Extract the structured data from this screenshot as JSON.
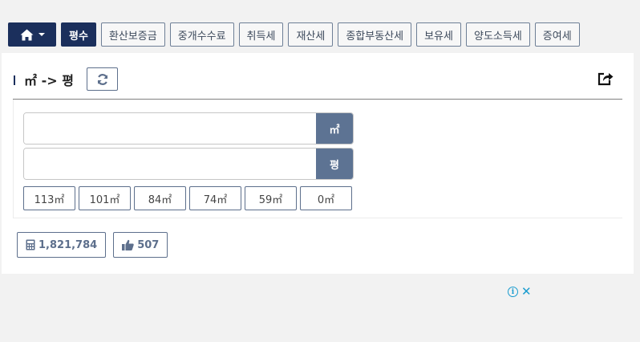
{
  "nav": {
    "home_icon": "home-icon",
    "items": [
      {
        "label": "평수",
        "active": true
      },
      {
        "label": "환산보증금"
      },
      {
        "label": "중개수수료"
      },
      {
        "label": "취득세"
      },
      {
        "label": "재산세"
      },
      {
        "label": "종합부동산세"
      },
      {
        "label": "보유세"
      },
      {
        "label": "양도소득세"
      },
      {
        "label": "증여세"
      }
    ]
  },
  "calculator": {
    "title": "㎡ -> 평",
    "refresh_icon": "refresh-icon",
    "share_icon": "share-icon",
    "input_sqm": {
      "value": "",
      "unit": "㎡"
    },
    "input_pyeong": {
      "value": "",
      "unit": "평"
    },
    "presets": [
      "113㎡",
      "101㎡",
      "84㎡",
      "74㎡",
      "59㎡",
      "0㎡"
    ]
  },
  "stats": {
    "views": "1,821,784",
    "likes": "507"
  },
  "colors": {
    "navy": "#1b2f5c",
    "unit_bg": "#5d7393",
    "border": "#5d6f8c",
    "ad_blue": "#1a9ccf"
  }
}
